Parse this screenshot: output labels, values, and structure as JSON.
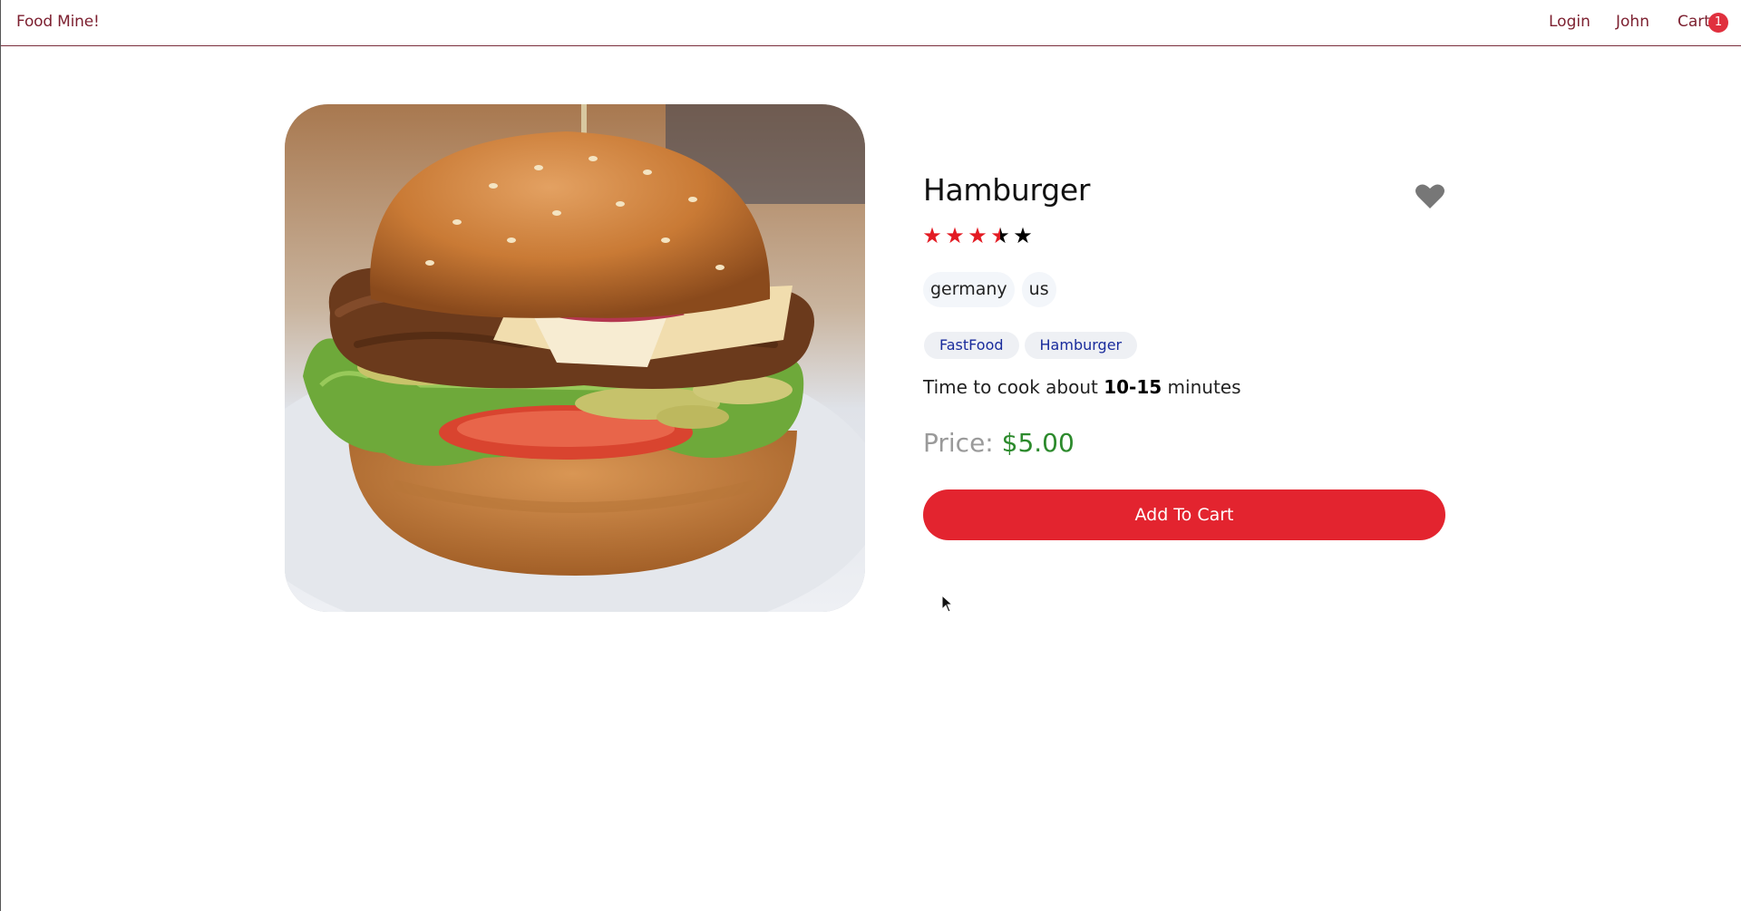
{
  "header": {
    "logo": "Food Mine!",
    "nav": {
      "login": "Login",
      "user": "John",
      "cart": "Cart",
      "cart_count": "1"
    }
  },
  "food": {
    "name": "Hamburger",
    "image_alt": "hamburger-photo",
    "rating": 3.5,
    "rating_max": 5,
    "stars": [
      "★",
      "★",
      "★",
      "★",
      "★"
    ],
    "origins": [
      "germany",
      "us"
    ],
    "tags": [
      "FastFood",
      "Hamburger"
    ],
    "cook_time_prefix": "Time to cook about",
    "cook_time": "10-15",
    "cook_time_suffix": "minutes",
    "price_label": "Price:",
    "price": "$5.00",
    "favorite_icon": "heart-icon"
  },
  "actions": {
    "add_to_cart": "Add To Cart"
  },
  "colors": {
    "brand": "#7c1f2f",
    "accent": "#e3242f",
    "star_full": "#e31b23",
    "price": "#2c8a2c",
    "tag_text": "#1a2c9c",
    "favorite": "#777777"
  }
}
